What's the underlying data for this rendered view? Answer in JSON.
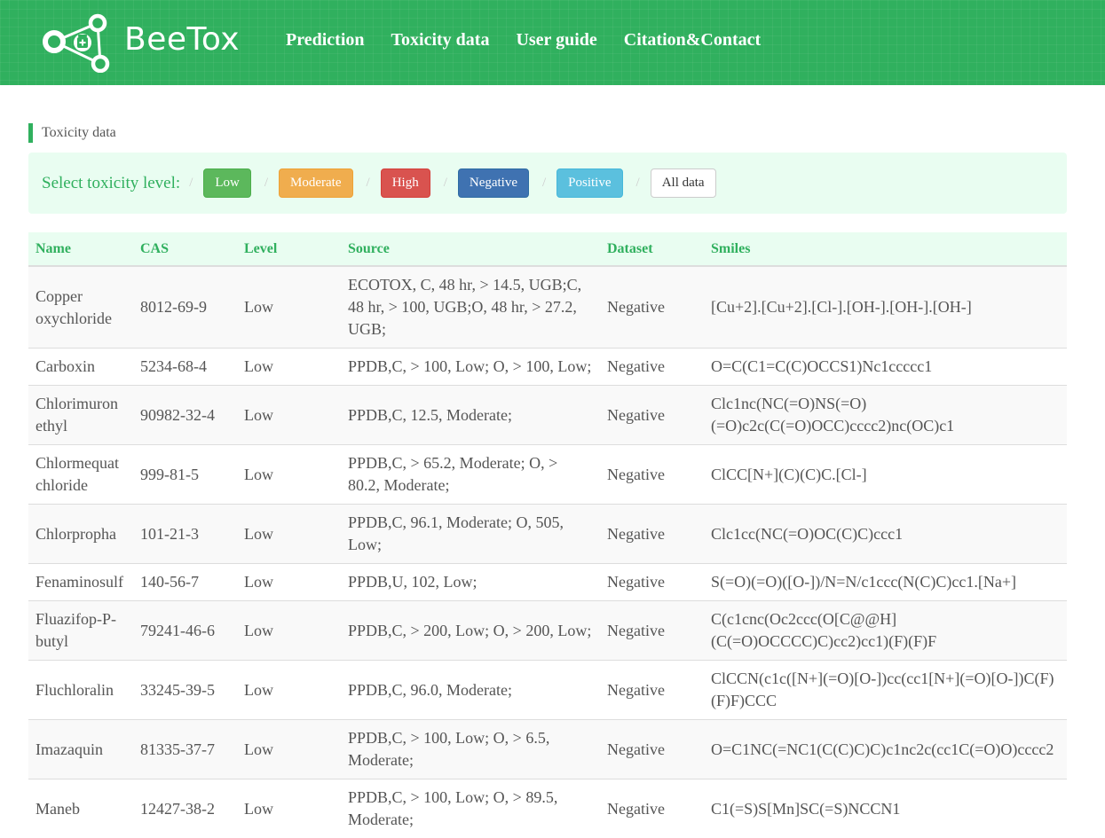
{
  "header": {
    "brand": "BeeTox",
    "logo_icon": "network-medicine-icon",
    "nav": [
      {
        "label": "Prediction"
      },
      {
        "label": "Toxicity data"
      },
      {
        "label": "User guide"
      },
      {
        "label": "Citation&Contact"
      }
    ],
    "brand_color": "#30b05e"
  },
  "section": {
    "title": "Toxicity data"
  },
  "filter": {
    "label": "Select toxicity level:",
    "separator": "/",
    "buttons": [
      {
        "label": "Low",
        "color": "#5cb85c"
      },
      {
        "label": "Moderate",
        "color": "#f0ad4e"
      },
      {
        "label": "High",
        "color": "#d9534f"
      },
      {
        "label": "Negative",
        "color": "#3f72b1"
      },
      {
        "label": "Positive",
        "color": "#5bc0de"
      },
      {
        "label": "All data",
        "color": "#ffffff"
      }
    ]
  },
  "table": {
    "columns": [
      "Name",
      "CAS",
      "Level",
      "Source",
      "Dataset",
      "Smiles"
    ],
    "rows": [
      {
        "name": "Copper oxychloride",
        "cas": "8012-69-9",
        "level": "Low",
        "source": "ECOTOX, C, 48 hr, > 14.5, UGB;C, 48 hr, > 100, UGB;O, 48 hr, > 27.2, UGB;",
        "dataset": "Negative",
        "smiles": "[Cu+2].[Cu+2].[Cl-].[OH-].[OH-].[OH-]"
      },
      {
        "name": "Carboxin",
        "cas": "5234-68-4",
        "level": "Low",
        "source": "PPDB,C, > 100, Low; O, > 100, Low;",
        "dataset": "Negative",
        "smiles": "O=C(C1=C(C)OCCS1)Nc1ccccc1"
      },
      {
        "name": "Chlorimuron ethyl",
        "cas": "90982-32-4",
        "level": "Low",
        "source": "PPDB,C, 12.5, Moderate;",
        "dataset": "Negative",
        "smiles": "Clc1nc(NC(=O)NS(=O)(=O)c2c(C(=O)OCC)cccc2)nc(OC)c1"
      },
      {
        "name": "Chlormequat chloride",
        "cas": "999-81-5",
        "level": "Low",
        "source": "PPDB,C, > 65.2, Moderate; O, > 80.2, Moderate;",
        "dataset": "Negative",
        "smiles": "ClCC[N+](C)(C)C.[Cl-]"
      },
      {
        "name": "Chlorpropha",
        "cas": "101-21-3",
        "level": "Low",
        "source": "PPDB,C, 96.1, Moderate; O, 505, Low;",
        "dataset": "Negative",
        "smiles": "Clc1cc(NC(=O)OC(C)C)ccc1"
      },
      {
        "name": "Fenaminosulf",
        "cas": "140-56-7",
        "level": "Low",
        "source": "PPDB,U, 102, Low;",
        "dataset": "Negative",
        "smiles": "S(=O)(=O)([O-])/N=N/c1ccc(N(C)C)cc1.[Na+]"
      },
      {
        "name": "Fluazifop-P-butyl",
        "cas": "79241-46-6",
        "level": "Low",
        "source": "PPDB,C, > 200, Low; O, > 200, Low;",
        "dataset": "Negative",
        "smiles": "C(c1cnc(Oc2ccc(O[C@@H](C(=O)OCCCC)C)cc2)cc1)(F)(F)F"
      },
      {
        "name": "Fluchloralin",
        "cas": "33245-39-5",
        "level": "Low",
        "source": "PPDB,C, 96.0, Moderate;",
        "dataset": "Negative",
        "smiles": "ClCCN(c1c([N+](=O)[O-])cc(cc1[N+](=O)[O-])C(F)(F)F)CCC"
      },
      {
        "name": "Imazaquin",
        "cas": "81335-37-7",
        "level": "Low",
        "source": "PPDB,C, > 100, Low; O, > 6.5, Moderate;",
        "dataset": "Negative",
        "smiles": "O=C1NC(=NC1(C(C)C)C)c1nc2c(cc1C(=O)O)cccc2"
      },
      {
        "name": "Maneb",
        "cas": "12427-38-2",
        "level": "Low",
        "source": "PPDB,C, > 100, Low; O, > 89.5, Moderate;",
        "dataset": "Negative",
        "smiles": "C1(=S)S[Mn]SC(=S)NCCN1"
      }
    ]
  }
}
